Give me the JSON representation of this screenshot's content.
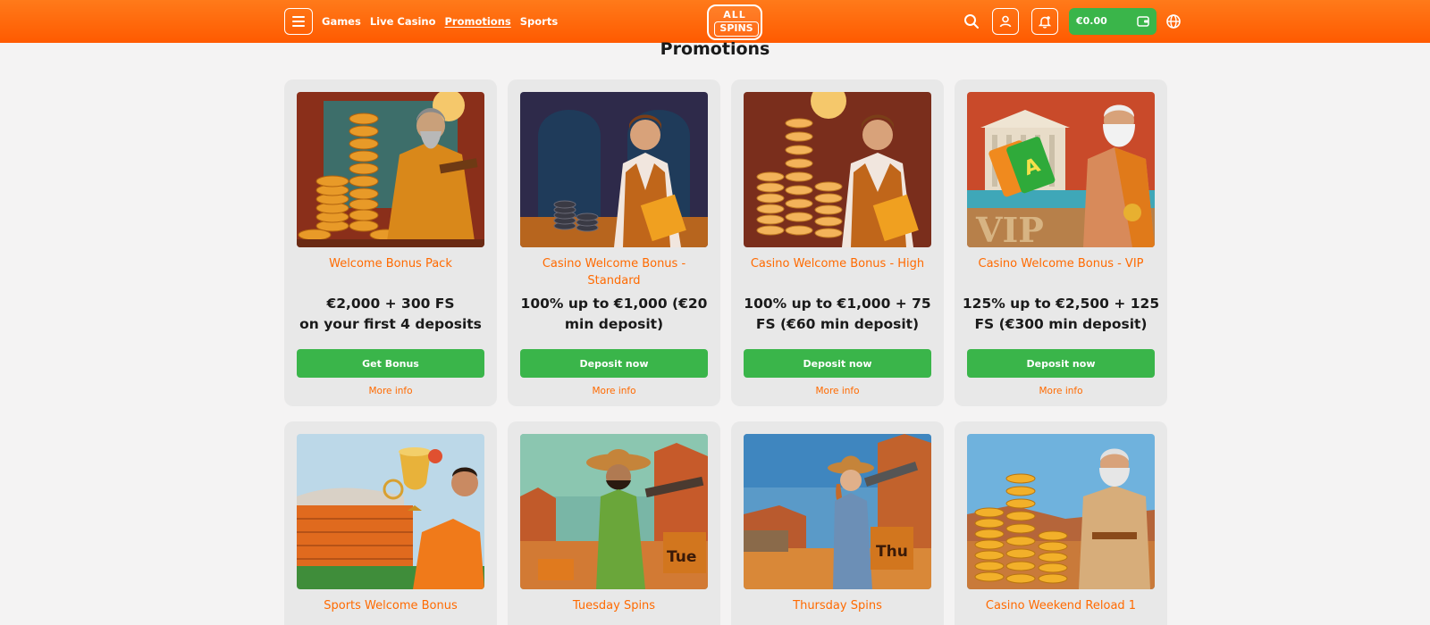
{
  "header": {
    "nav": [
      {
        "label": "Games"
      },
      {
        "label": "Live Casino"
      },
      {
        "label": "Promotions"
      },
      {
        "label": "Sports"
      }
    ],
    "logo_top": "ALL",
    "logo_bottom": "SPINS",
    "balance": "€0.00",
    "accent": "#ff6a00",
    "green": "#3ab54a"
  },
  "page": {
    "title": "Promotions"
  },
  "promotions": [
    {
      "title": "Welcome Bonus Pack",
      "offer_line1": "€2,000 + 300 FS",
      "offer_line2": "on your first 4 deposits",
      "cta": "Get Bonus",
      "more": "More info"
    },
    {
      "title": "Casino Welcome Bonus - Standard",
      "offer_line1": "100% up to €1,000 (€20",
      "offer_line2": "min deposit)",
      "cta": "Deposit now",
      "more": "More info"
    },
    {
      "title": "Casino Welcome Bonus - High",
      "offer_line1": "100% up to €1,000 + 75",
      "offer_line2": "FS (€60 min deposit)",
      "cta": "Deposit now",
      "more": "More info"
    },
    {
      "title": "Casino Welcome Bonus - VIP",
      "offer_line1": "125% up to €2,500 + 125",
      "offer_line2": "FS (€300 min deposit)",
      "cta": "Deposit now",
      "more": "More info",
      "image_text": "VIP"
    },
    {
      "title": "Sports Welcome Bonus"
    },
    {
      "title": "Tuesday Spins",
      "image_text": "Tue"
    },
    {
      "title": "Thursday Spins",
      "image_text": "Thu"
    },
    {
      "title": "Casino Weekend Reload 1"
    }
  ]
}
